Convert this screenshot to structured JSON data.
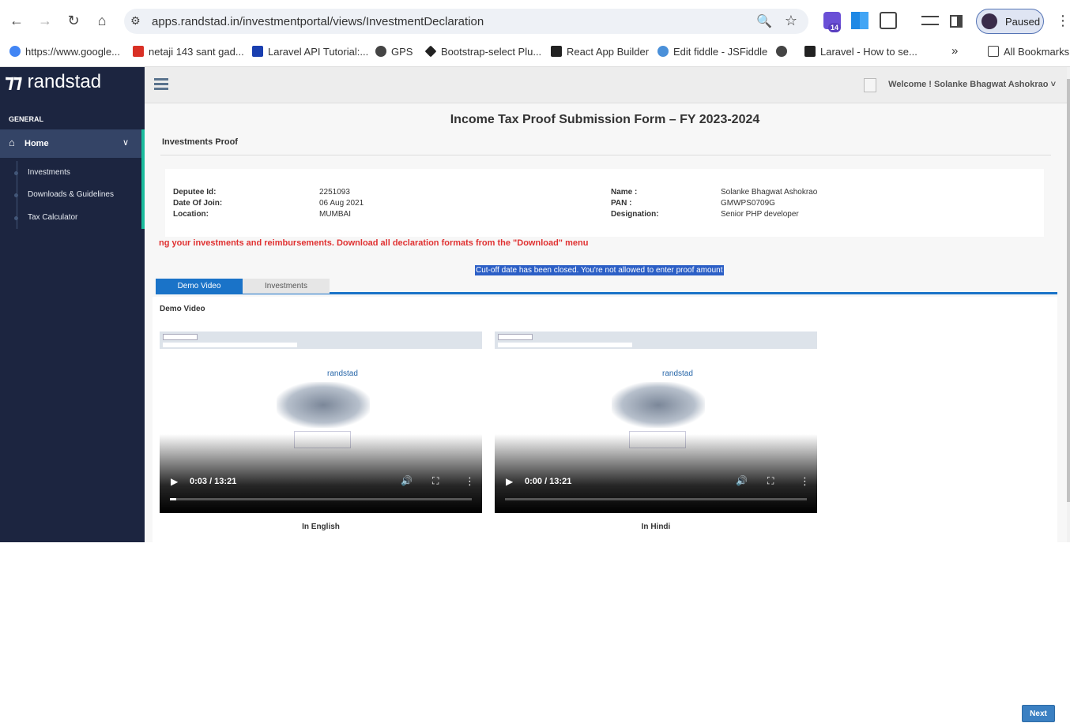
{
  "browser": {
    "url": "apps.randstad.in/investmentportal/views/InvestmentDeclaration",
    "ext_badge": "14",
    "profile_label": "Paused",
    "bookmarks": [
      {
        "label": "https://www.google...",
        "color": "#4285f4"
      },
      {
        "label": "netaji 143 sant gad...",
        "color": "#d93025"
      },
      {
        "label": "Laravel API Tutorial:...",
        "color": "#1a3fb0"
      },
      {
        "label": "GPS",
        "color": "#444444"
      },
      {
        "label": "Bootstrap-select Plu...",
        "color": "#222222"
      },
      {
        "label": "React App Builder",
        "color": "#222222"
      },
      {
        "label": "Edit fiddle - JSFiddle",
        "color": "#4a90d9"
      },
      {
        "label": "",
        "color": "#444444"
      },
      {
        "label": "Laravel - How to se...",
        "color": "#222222"
      }
    ],
    "all_bookmarks": "All Bookmarks"
  },
  "sidebar": {
    "brand": "randstad",
    "section": "GENERAL",
    "home": "Home",
    "items": [
      "Investments",
      "Downloads & Guidelines",
      "Tax Calculator"
    ]
  },
  "header": {
    "welcome": "Welcome ! Solanke Bhagwat Ashokrao"
  },
  "form": {
    "title": "Income Tax Proof Submission Form – FY 2023-2024",
    "section": "Investments Proof",
    "fields": {
      "deputee_label": "Deputee Id:",
      "deputee_value": "2251093",
      "doj_label": "Date Of Join:",
      "doj_value": "06 Aug 2021",
      "location_label": "Location:",
      "location_value": "MUMBAI",
      "name_label": "Name :",
      "name_value": "Solanke Bhagwat Ashokrao",
      "pan_label": "PAN :",
      "pan_value": "GMWPS0709G",
      "designation_label": "Designation:",
      "designation_value": "Senior PHP developer"
    },
    "notice": "ng your investments and reimbursements. Download all declaration formats from the \"Download\" menu",
    "cutoff": "Cut-off date has been closed. You're not allowed to enter proof amount"
  },
  "tabs": [
    "Demo Video",
    "Investments"
  ],
  "panel": {
    "title": "Demo Video",
    "videos": [
      {
        "time": "0:03 / 13:21",
        "progress": 0.02,
        "caption": "In English",
        "brand": "randstad"
      },
      {
        "time": "0:00 / 13:21",
        "progress": 0.0,
        "caption": "In Hindi",
        "brand": "randstad"
      }
    ]
  },
  "next_label": "Next"
}
